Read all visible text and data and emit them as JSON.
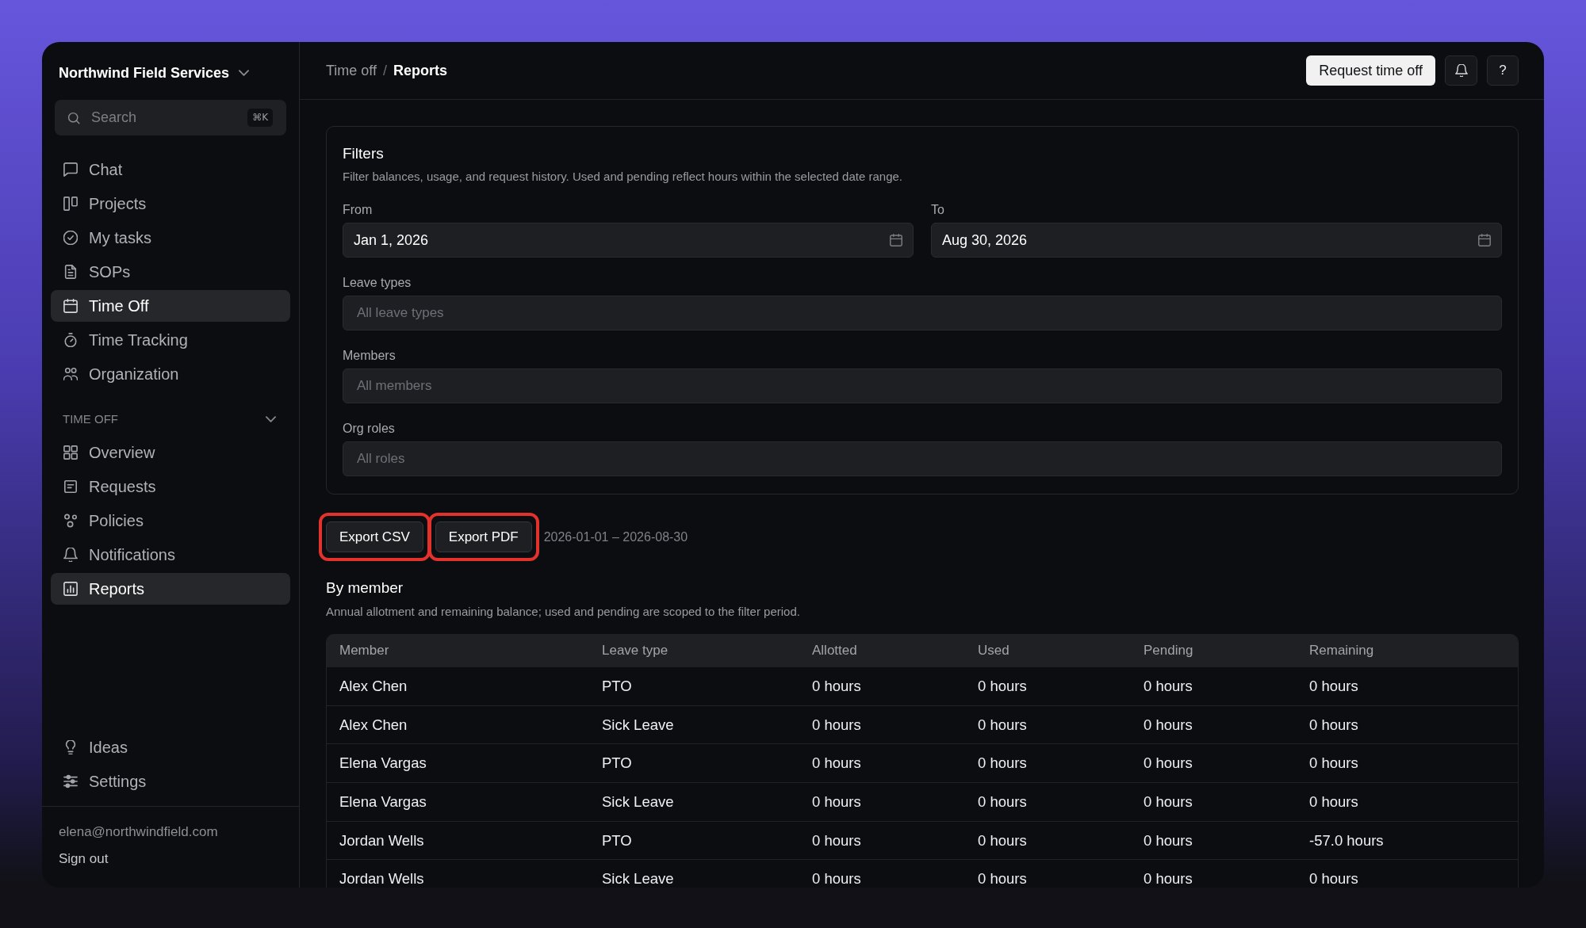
{
  "sidebar": {
    "workspace": "Northwind Field Services",
    "search": {
      "placeholder": "Search",
      "shortcut": "⌘K"
    },
    "nav": [
      {
        "label": "Chat",
        "selected": false
      },
      {
        "label": "Projects",
        "selected": false
      },
      {
        "label": "My tasks",
        "selected": false
      },
      {
        "label": "SOPs",
        "selected": false
      },
      {
        "label": "Time Off",
        "selected": true
      },
      {
        "label": "Time Tracking",
        "selected": false
      },
      {
        "label": "Organization",
        "selected": false
      }
    ],
    "section": {
      "title": "TIME OFF",
      "expanded": true,
      "items": [
        {
          "label": "Overview",
          "selected": false
        },
        {
          "label": "Requests",
          "selected": false
        },
        {
          "label": "Policies",
          "selected": false
        },
        {
          "label": "Notifications",
          "selected": false
        },
        {
          "label": "Reports",
          "selected": true
        }
      ]
    },
    "bottom_nav": [
      {
        "label": "Ideas",
        "selected": false
      },
      {
        "label": "Settings",
        "selected": false
      }
    ],
    "account": {
      "email": "elena@northwindfield.com",
      "sign_out": "Sign out"
    }
  },
  "header": {
    "breadcrumb": [
      {
        "label": "Time off",
        "current": false
      },
      {
        "label": "Reports",
        "current": true
      }
    ],
    "separator": "/",
    "primary_button": "Request time off",
    "help_button": "?"
  },
  "filters": {
    "title": "Filters",
    "description": "Filter balances, usage, and request history. Used and pending reflect hours within the selected date range.",
    "date_fields": [
      {
        "label": "From",
        "value": "Jan 1, 2026"
      },
      {
        "label": "To",
        "value": "Aug 30, 2026"
      }
    ],
    "select_fields": [
      {
        "label": "Leave types",
        "placeholder": "All leave types"
      },
      {
        "label": "Members",
        "placeholder": "All members"
      },
      {
        "label": "Org roles",
        "placeholder": "All roles"
      }
    ]
  },
  "export": {
    "buttons": [
      {
        "label": "Export CSV",
        "highlighted": true
      },
      {
        "label": "Export PDF",
        "highlighted": true
      }
    ],
    "range": "2026-01-01 – 2026-08-30"
  },
  "by_member": {
    "title": "By member",
    "description": "Annual allotment and remaining balance; used and pending are scoped to the filter period.",
    "table": {
      "columns": [
        "Member",
        "Leave type",
        "Allotted",
        "Used",
        "Pending",
        "Remaining"
      ],
      "rows": [
        [
          "Alex Chen",
          "PTO",
          "0 hours",
          "0 hours",
          "0 hours",
          "0 hours"
        ],
        [
          "Alex Chen",
          "Sick Leave",
          "0 hours",
          "0 hours",
          "0 hours",
          "0 hours"
        ],
        [
          "Elena Vargas",
          "PTO",
          "0 hours",
          "0 hours",
          "0 hours",
          "0 hours"
        ],
        [
          "Elena Vargas",
          "Sick Leave",
          "0 hours",
          "0 hours",
          "0 hours",
          "0 hours"
        ],
        [
          "Jordan Wells",
          "PTO",
          "0 hours",
          "0 hours",
          "0 hours",
          "-57.0 hours"
        ],
        [
          "Jordan Wells",
          "Sick Leave",
          "0 hours",
          "0 hours",
          "0 hours",
          "0 hours"
        ]
      ]
    }
  }
}
